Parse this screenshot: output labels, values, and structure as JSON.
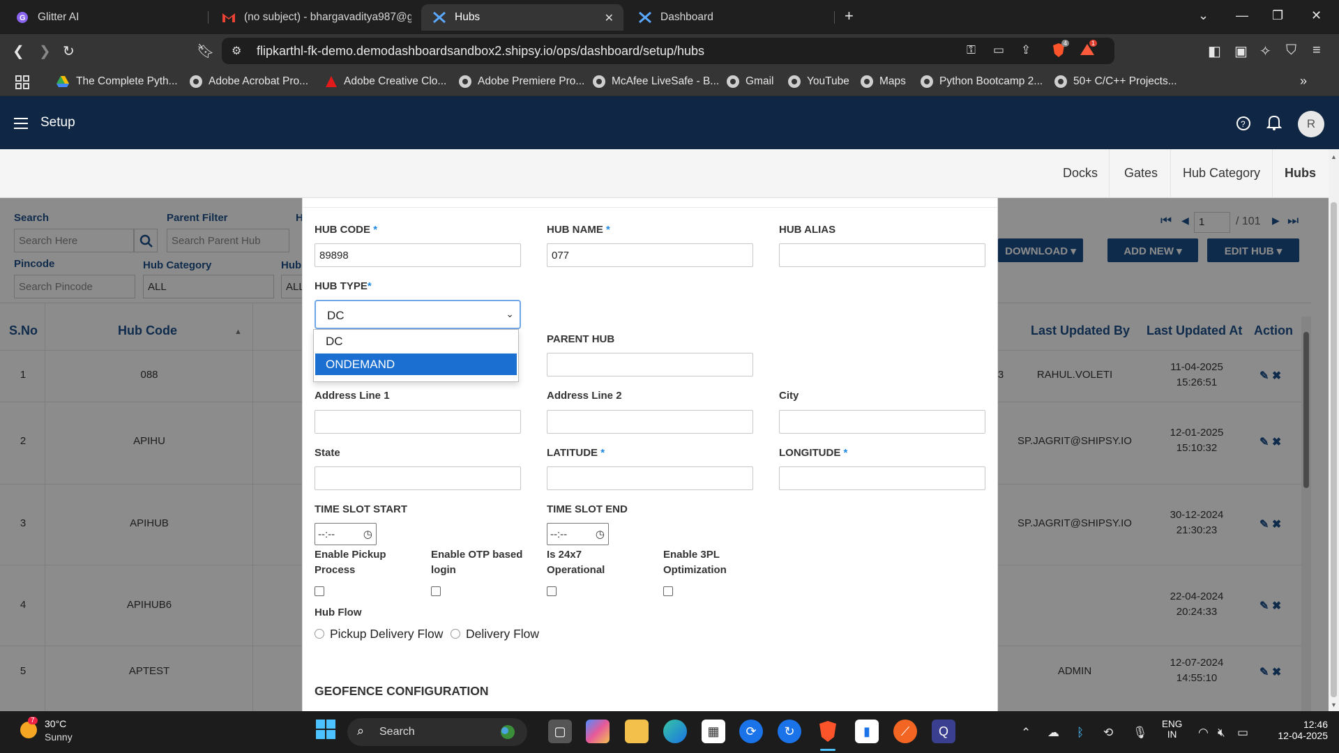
{
  "browser": {
    "tabs": [
      {
        "label": "Glitter AI",
        "icon": "glitter-icon"
      },
      {
        "label": "(no subject) - bhargavaditya987@g",
        "icon": "gmail-icon"
      },
      {
        "label": "Hubs",
        "icon": "shipsy-icon",
        "active": true
      },
      {
        "label": "Dashboard",
        "icon": "shipsy-icon"
      }
    ],
    "url": "flipkarthl-fk-demo.demodashboardsandbox2.shipsy.io/ops/dashboard/setup/hubs",
    "bookmarks": [
      "The Complete Pyth...",
      "Adobe Acrobat Pro...",
      "Adobe Creative Clo...",
      "Adobe Premiere Pro...",
      "McAfee LiveSafe - B...",
      "Gmail",
      "YouTube",
      "Maps",
      "Python Bootcamp 2...",
      "50+ C/C++ Projects..."
    ],
    "badges": {
      "brave": "4",
      "alerts": "1"
    }
  },
  "app": {
    "title": "Setup",
    "avatar": "R",
    "subtabs": [
      "Docks",
      "Gates",
      "Hub Category",
      "Hubs"
    ]
  },
  "filters": {
    "search_label": "Search",
    "search_placeholder": "Search Here",
    "parent_label": "Parent Filter",
    "parent_placeholder": "Search Parent Hub",
    "h_label": "H",
    "pincode_label": "Pincode",
    "pincode_placeholder": "Search Pincode",
    "hubcat_label": "Hub Category",
    "hubcat_value": "ALL",
    "hub_label": "Hub",
    "hub_value": "ALL"
  },
  "pagination": {
    "page": "1",
    "total": "/ 101"
  },
  "actions": {
    "download": "DOWNLOAD",
    "add_new": "ADD NEW",
    "edit_hub": "EDIT HUB"
  },
  "table": {
    "headers": {
      "sno": "S.No",
      "hub_code": "Hub Code",
      "last_updated_by": "Last Updated By",
      "last_updated_at": "Last Updated At",
      "action": "Action"
    },
    "rows": [
      {
        "sno": "1",
        "code": "088",
        "by": "RAHUL.VOLETI",
        "date": "11-04-2025",
        "time": "15:26:51",
        "extra": "3"
      },
      {
        "sno": "2",
        "code": "APIHU",
        "by": "SP.JAGRIT@SHIPSY.IO",
        "date": "12-01-2025",
        "time": "15:10:32",
        "extra": ""
      },
      {
        "sno": "3",
        "code": "APIHUB",
        "by": "SP.JAGRIT@SHIPSY.IO",
        "date": "30-12-2024",
        "time": "21:30:23",
        "extra": ""
      },
      {
        "sno": "4",
        "code": "APIHUB6",
        "by": "",
        "date": "22-04-2024",
        "time": "20:24:33",
        "extra": ""
      },
      {
        "sno": "5",
        "code": "APTEST",
        "by": "ADMIN",
        "date": "12-07-2024",
        "time": "14:55:10",
        "extra": ""
      }
    ]
  },
  "modal": {
    "hub_code_label": "HUB CODE",
    "hub_code_value": "89898",
    "hub_name_label": "HUB NAME",
    "hub_name_value": "077",
    "hub_alias_label": "HUB ALIAS",
    "hub_type_label": "HUB TYPE",
    "hub_type_value": "DC",
    "hub_type_options": [
      "DC",
      "ONDEMAND"
    ],
    "parent_hub_label": "PARENT HUB",
    "address1_label": "Address Line 1",
    "address2_label": "Address Line 2",
    "city_label": "City",
    "state_label": "State",
    "latitude_label": "LATITUDE",
    "longitude_label": "LONGITUDE",
    "time_start_label": "TIME SLOT START",
    "time_end_label": "TIME SLOT END",
    "time_placeholder": "--:--",
    "checkboxes": [
      "Enable Pickup Process",
      "Enable OTP based login",
      "Is 24x7 Operational",
      "Enable 3PL Optimization"
    ],
    "hub_flow_label": "Hub Flow",
    "flow_options": [
      "Pickup Delivery Flow",
      "Delivery Flow"
    ],
    "geofence_label": "GEOFENCE CONFIGURATION",
    "required_mark": "*"
  },
  "taskbar": {
    "weather_temp": "30°C",
    "weather_desc": "Sunny",
    "weather_badge": "7",
    "search": "Search",
    "lang": "ENG",
    "region": "IN",
    "time": "12:46",
    "date": "12-04-2025"
  }
}
